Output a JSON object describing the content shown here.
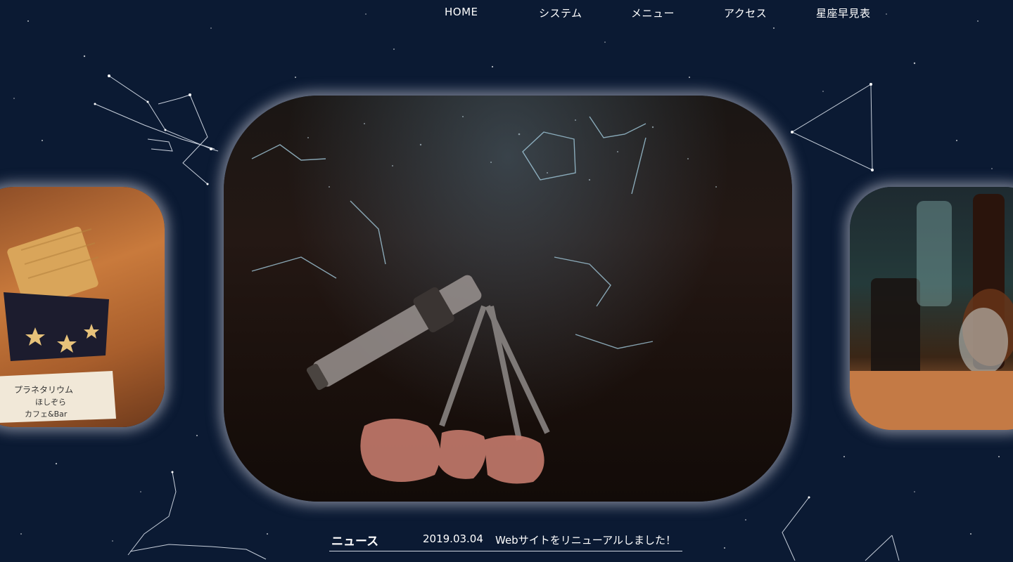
{
  "nav": {
    "items": [
      {
        "label": "HOME"
      },
      {
        "label": "システム"
      },
      {
        "label": "メニュー"
      },
      {
        "label": "アクセス"
      },
      {
        "label": "星座早見表"
      }
    ]
  },
  "slides": {
    "left": {
      "handwritten_sign": "プラネタリウム ほしぞら カフェ&Bar"
    }
  },
  "news": {
    "heading": "ニュース",
    "date": "2019.03.04",
    "text": "Webサイトをリニューアルしました！"
  },
  "colors": {
    "background": "#0b1a33",
    "accent": "#ffffff"
  }
}
